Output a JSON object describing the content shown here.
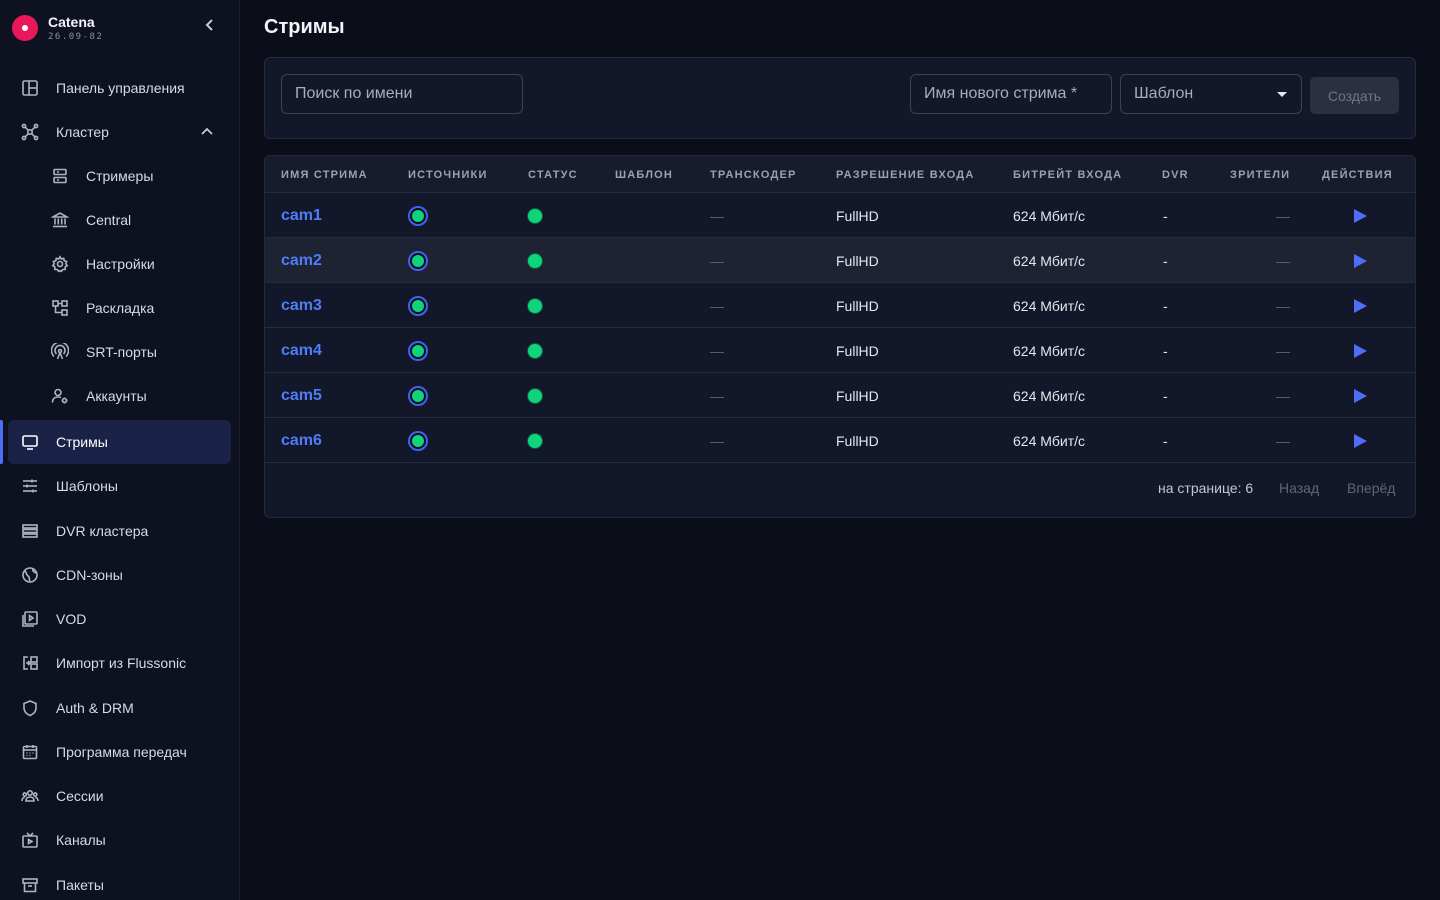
{
  "app": {
    "name": "Catena",
    "version": "26.09-82"
  },
  "sidebar": {
    "items": [
      {
        "label": "Панель управления",
        "icon": "dashboard-icon"
      },
      {
        "label": "Кластер",
        "icon": "cluster-icon",
        "expanded": true
      },
      {
        "label": "Стримеры",
        "icon": "server-icon",
        "sub": true
      },
      {
        "label": "Central",
        "icon": "bank-icon",
        "sub": true
      },
      {
        "label": "Настройки",
        "icon": "gear-icon",
        "sub": true
      },
      {
        "label": "Раскладка",
        "icon": "layout-icon",
        "sub": true
      },
      {
        "label": "SRT-порты",
        "icon": "antenna-icon",
        "sub": true
      },
      {
        "label": "Аккаунты",
        "icon": "user-gear-icon",
        "sub": true
      },
      {
        "label": "Стримы",
        "icon": "monitor-icon",
        "active": true
      },
      {
        "label": "Шаблоны",
        "icon": "sliders-icon"
      },
      {
        "label": "DVR кластера",
        "icon": "list-icon"
      },
      {
        "label": "CDN-зоны",
        "icon": "globe-icon"
      },
      {
        "label": "VOD",
        "icon": "video-file-icon"
      },
      {
        "label": "Импорт из Flussonic",
        "icon": "import-icon"
      },
      {
        "label": "Auth & DRM",
        "icon": "shield-icon"
      },
      {
        "label": "Программа передач",
        "icon": "calendar-icon"
      },
      {
        "label": "Сессии",
        "icon": "users-icon"
      },
      {
        "label": "Каналы",
        "icon": "tv-icon"
      },
      {
        "label": "Пакеты",
        "icon": "archive-icon"
      }
    ]
  },
  "main": {
    "title": "Стримы",
    "search_placeholder": "Поиск по имени",
    "name_placeholder": "Имя нового стрима *",
    "template_value": "Шаблон",
    "create_label": "Создать"
  },
  "table": {
    "columns": [
      "Имя стрима",
      "Источники",
      "Статус",
      "Шаблон",
      "Транскодер",
      "Разрешение входа",
      "Битрейт входа",
      "DVR",
      "Зрители",
      "Действия"
    ],
    "rows": [
      {
        "name": "cam1",
        "template": "",
        "transcoder": "—",
        "resolution": "FullHD",
        "bitrate": "624 Мбит/с",
        "dvr": "-",
        "viewers": "—"
      },
      {
        "name": "cam2",
        "template": "",
        "transcoder": "—",
        "resolution": "FullHD",
        "bitrate": "624 Мбит/с",
        "dvr": "-",
        "viewers": "—"
      },
      {
        "name": "cam3",
        "template": "",
        "transcoder": "—",
        "resolution": "FullHD",
        "bitrate": "624 Мбит/с",
        "dvr": "-",
        "viewers": "—"
      },
      {
        "name": "cam4",
        "template": "",
        "transcoder": "—",
        "resolution": "FullHD",
        "bitrate": "624 Мбит/с",
        "dvr": "-",
        "viewers": "—"
      },
      {
        "name": "cam5",
        "template": "",
        "transcoder": "—",
        "resolution": "FullHD",
        "bitrate": "624 Мбит/с",
        "dvr": "-",
        "viewers": "—"
      },
      {
        "name": "cam6",
        "template": "",
        "transcoder": "—",
        "resolution": "FullHD",
        "bitrate": "624 Мбит/с",
        "dvr": "-",
        "viewers": "—"
      }
    ],
    "per_page": "на странице: 6",
    "prev_label": "Назад",
    "next_label": "Вперёд"
  },
  "colors": {
    "accent": "#4f6ef7",
    "status_ok": "#10d47c",
    "link": "#4f7cf7",
    "brand": "#e8185a"
  }
}
